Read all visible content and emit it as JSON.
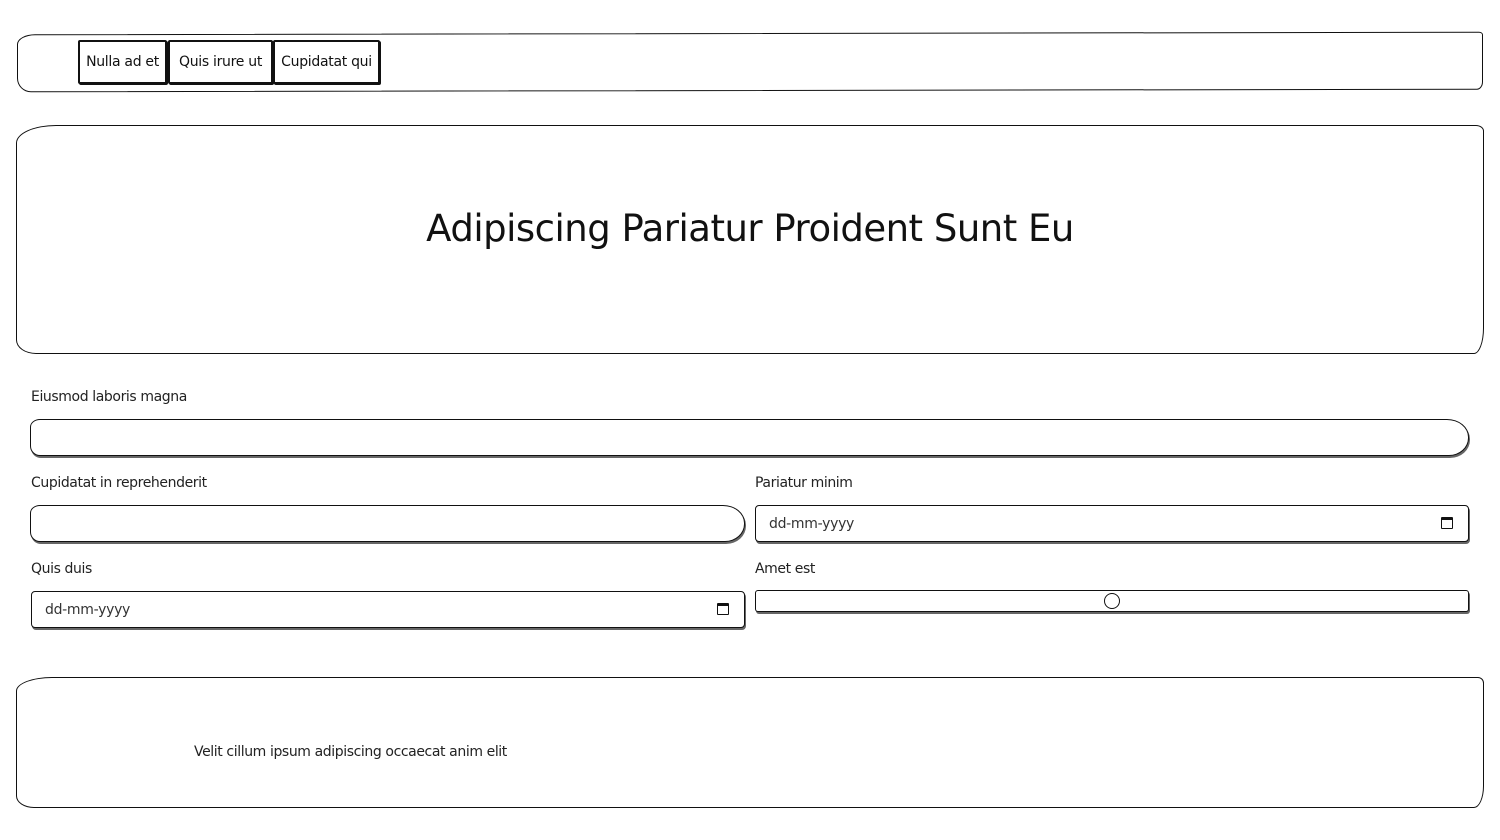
{
  "nav": {
    "items": [
      {
        "label": "Nulla ad et"
      },
      {
        "label": "Quis irure ut"
      },
      {
        "label": "Cupidatat qui"
      }
    ]
  },
  "hero": {
    "title": "Adipiscing Pariatur Proident Sunt Eu"
  },
  "form": {
    "field1": {
      "label": "Eiusmod laboris magna",
      "value": ""
    },
    "field2": {
      "label": "Cupidatat in reprehenderit",
      "value": ""
    },
    "field3": {
      "label": "Pariatur minim",
      "placeholder": "dd-mm-yyyy"
    },
    "field4": {
      "label": "Quis duis",
      "placeholder": "dd-mm-yyyy"
    },
    "field5": {
      "label": "Amet est",
      "value_fraction": 0.5
    }
  },
  "footer": {
    "text": "Velit cillum ipsum adipiscing occaecat anim elit"
  },
  "icons": {
    "calendar": "calendar-icon"
  }
}
